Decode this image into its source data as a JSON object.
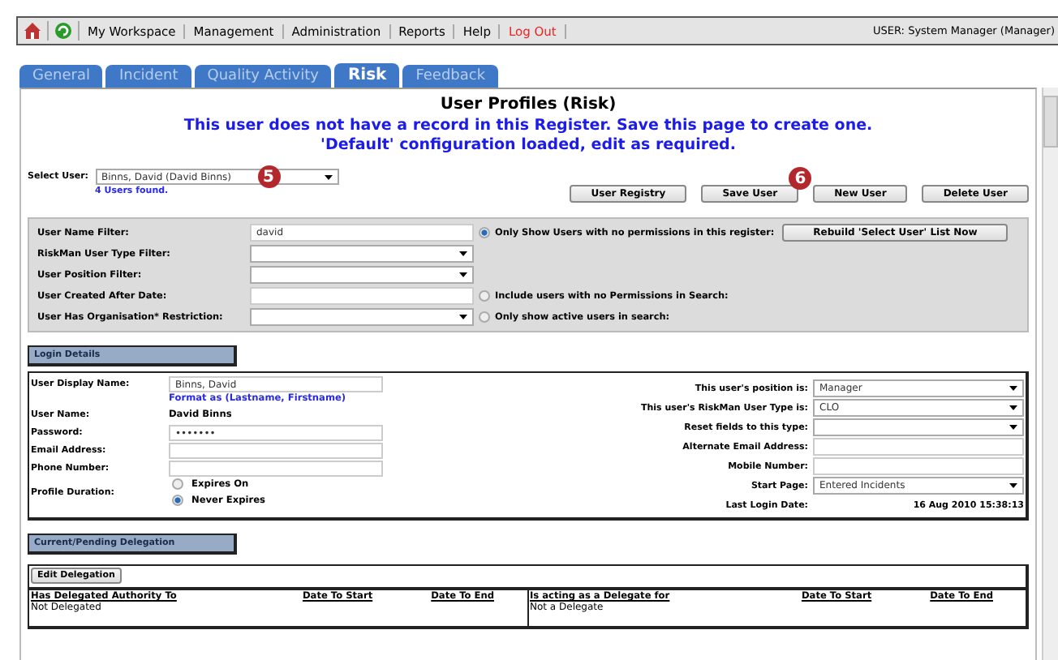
{
  "menu": {
    "items": [
      {
        "label": "My Workspace",
        "kind": "link"
      },
      {
        "label": "Management",
        "kind": "link"
      },
      {
        "label": "Administration",
        "kind": "link"
      },
      {
        "label": "Reports",
        "kind": "link"
      },
      {
        "label": "Help",
        "kind": "link"
      },
      {
        "label": "Log Out",
        "kind": "logout"
      }
    ],
    "user": "USER: System Manager (Manager)"
  },
  "tabs": [
    {
      "label": "General",
      "selected": false
    },
    {
      "label": "Incident",
      "selected": false
    },
    {
      "label": "Quality Activity",
      "selected": false
    },
    {
      "label": "Risk",
      "selected": true
    },
    {
      "label": "Feedback",
      "selected": false
    }
  ],
  "title": "User Profiles (Risk)",
  "notice": [
    "This user does not have a record in this Register. Save this page to create one.",
    "'Default' configuration loaded, edit as required."
  ],
  "select_user": {
    "label": "Select User:",
    "value": "Binns, David (David Binns)",
    "found": "4 Users found.",
    "callout": "5"
  },
  "buttons": [
    {
      "label": "User Registry"
    },
    {
      "label": "Save User",
      "callout": "6"
    },
    {
      "label": "New User"
    },
    {
      "label": "Delete User"
    }
  ],
  "filters": [
    {
      "label": "User Name Filter:",
      "kind": "text",
      "value": "david",
      "option": {
        "label": "Only Show Users with no permissions in this register:",
        "selected": true
      },
      "button": "Rebuild 'Select User' List Now"
    },
    {
      "label": "RiskMan User Type Filter:",
      "kind": "select"
    },
    {
      "label": "User Position Filter:",
      "kind": "select"
    },
    {
      "label": "User Created After Date:",
      "kind": "text",
      "option": {
        "label": "Include users with no Permissions in Search:",
        "selected": false
      }
    },
    {
      "label": "User Has Organisation* Restriction:",
      "kind": "select",
      "option": {
        "label": "Only show active users in search:",
        "selected": false
      }
    }
  ],
  "login_details": {
    "heading": "Login Details",
    "left": [
      {
        "label": "User Display Name:",
        "kind": "text",
        "value": "Binns, David",
        "hint": "Format as (Lastname, Firstname)"
      },
      {
        "label": "User Name:",
        "kind": "static",
        "value": "David Binns"
      },
      {
        "label": "Password:",
        "kind": "text",
        "value": "•••••••"
      },
      {
        "label": "Email Address:",
        "kind": "text"
      },
      {
        "label": "Phone Number:",
        "kind": "text"
      },
      {
        "label": "Profile Duration:",
        "kind": "radios",
        "options": [
          {
            "label": "Expires On",
            "selected": false
          },
          {
            "label": "Never Expires",
            "selected": true
          }
        ]
      }
    ],
    "right": [
      {
        "label": "This user's position is:",
        "kind": "select",
        "value": "Manager"
      },
      {
        "label": "This user's RiskMan User Type is:",
        "kind": "select",
        "value": "CLO"
      },
      {
        "label": "Reset fields to this type:",
        "kind": "select"
      },
      {
        "label": "Alternate Email Address:",
        "kind": "text"
      },
      {
        "label": "Mobile Number:",
        "kind": "text"
      },
      {
        "label": "Start Page:",
        "kind": "select",
        "value": "Entered Incidents"
      },
      {
        "label": "Last Login Date:",
        "kind": "static",
        "value": "16 Aug 2010 15:38:13"
      }
    ]
  },
  "delegation": {
    "heading": "Current/Pending Delegation",
    "button": "Edit Delegation",
    "tables": [
      {
        "columns": [
          "Has Delegated Authority To",
          "Date To Start",
          "Date To End"
        ],
        "row": [
          "Not Delegated"
        ]
      },
      {
        "columns": [
          "Is acting as a Delegate for",
          "Date To Start",
          "Date To End"
        ],
        "row": [
          "Not a Delegate"
        ]
      }
    ]
  }
}
